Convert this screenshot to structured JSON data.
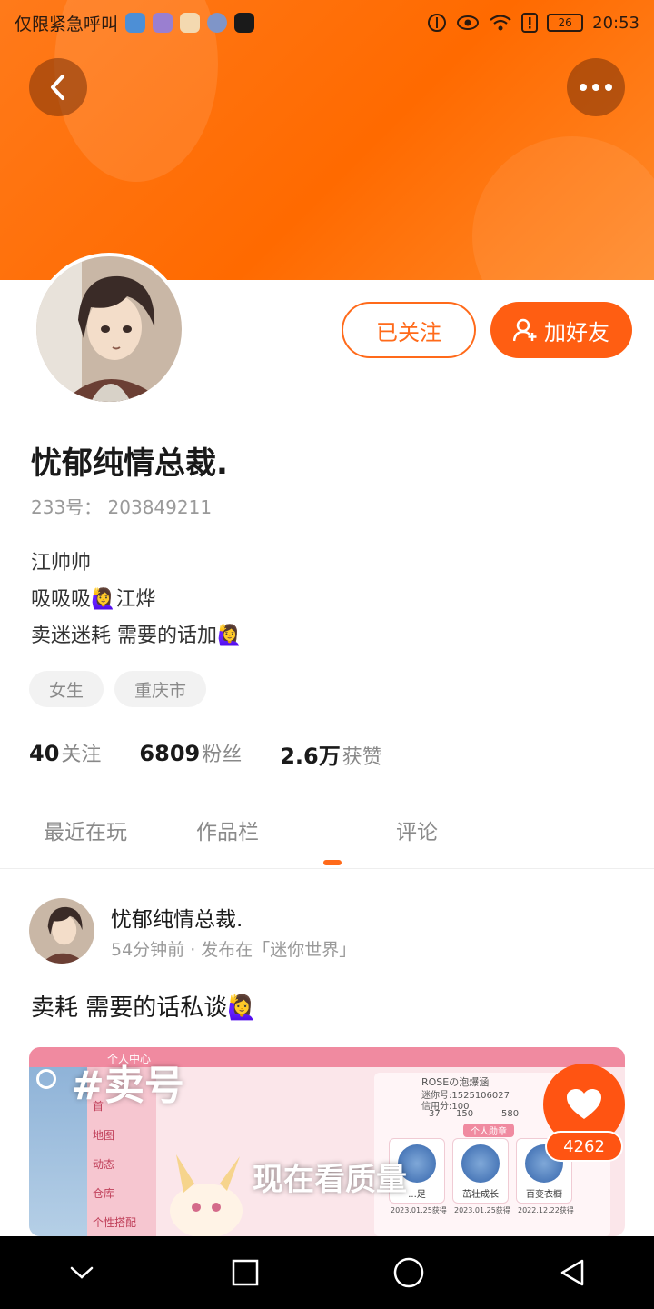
{
  "status_bar": {
    "carrier_text": "仅限紧急呼叫",
    "time": "20:53",
    "battery": "26"
  },
  "header": {
    "back_icon": "chevron-left-icon",
    "more_icon": "more-dots-icon"
  },
  "profile": {
    "follow_button_label": "已关注",
    "add_friend_label": "加好友",
    "add_friend_icon": "add-user-icon",
    "name": "忧郁纯情总裁.",
    "id_text": "233号： 203849211",
    "bio_lines": [
      "江帅帅",
      "吸吸吸🙋‍♀️江烨",
      "卖迷迷耗 需要的话加🙋‍♀️"
    ],
    "tags": [
      "女生",
      "重庆市"
    ],
    "stats": [
      {
        "value": "40",
        "label": "关注"
      },
      {
        "value": "6809",
        "label": "粉丝"
      },
      {
        "value": "2.6万",
        "label": "获赞"
      }
    ]
  },
  "tabs": [
    "最近在玩",
    "作品栏",
    "评论"
  ],
  "post": {
    "author": "忧郁纯情总裁.",
    "meta": "54分钟前 · 发布在「迷你世界」",
    "text": "卖耗 需要的话私谈🙋‍♀️",
    "media": {
      "overlay_tag": "#卖号",
      "overlay_caption": "现在看质量",
      "game_nav": [
        "首",
        "地图",
        "动态",
        "仓库",
        "个性搭配"
      ],
      "game_top_label": "个人中心",
      "game_player": "ROSEの泡爆涵",
      "game_id": "迷你号:1525106027",
      "game_credit": "信用分:100",
      "game_numbers": [
        "37",
        "150",
        "580"
      ],
      "game_section": "个人勋章",
      "badges": [
        "...足",
        "茁壮成长",
        "百变衣橱"
      ],
      "badge_dates": [
        "2023.01.25获得",
        "2023.01.25获得",
        "2022.12.22获得"
      ]
    },
    "like_count": "4262",
    "like_icon": "heart-icon"
  },
  "nav_bar": {
    "icons": [
      "nav-back-chevron-icon",
      "nav-recents-icon",
      "nav-home-icon",
      "nav-back-triangle-icon"
    ]
  },
  "colors": {
    "accent": "#ff5e12",
    "header_orange": "#ff7a1a"
  }
}
